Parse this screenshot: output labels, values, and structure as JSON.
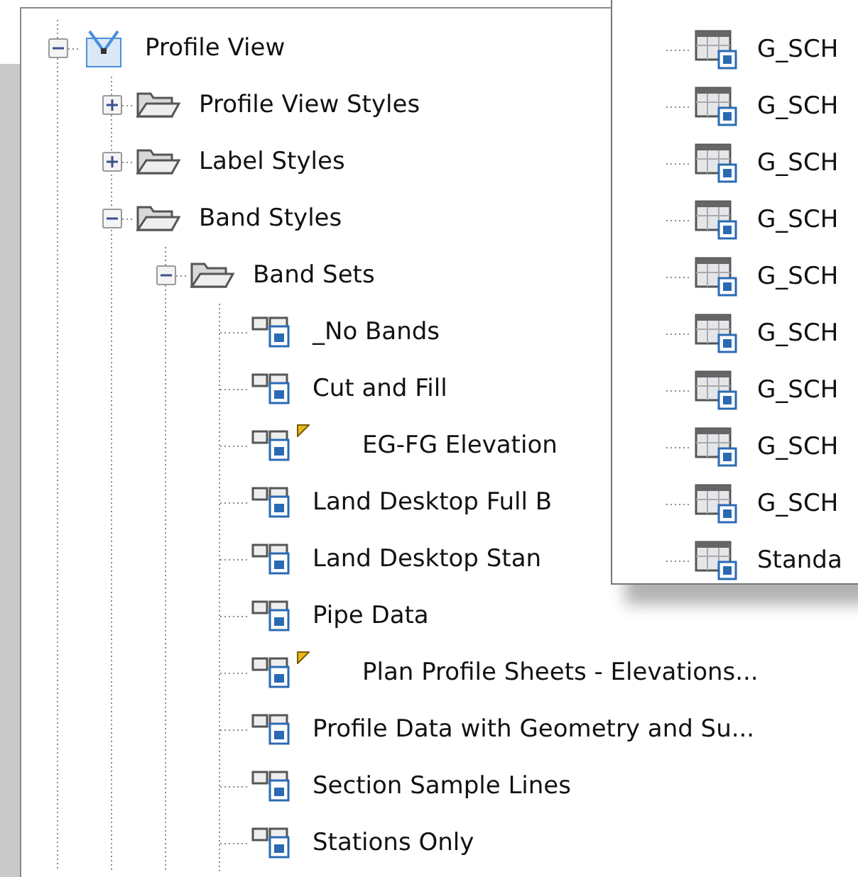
{
  "tree": [
    {
      "label": "Profile View",
      "kind": "profile-view",
      "expanded": true,
      "children": [
        {
          "label": "Profile View Styles",
          "kind": "folder",
          "expanded": false
        },
        {
          "label": "Label Styles",
          "kind": "folder",
          "expanded": false
        },
        {
          "label": "Band Styles",
          "kind": "folder",
          "expanded": true,
          "children": [
            {
              "label": "Band Sets",
              "kind": "folder",
              "expanded": true,
              "children": [
                {
                  "label": "_No Bands",
                  "kind": "band-set",
                  "flagged": false
                },
                {
                  "label": "Cut and Fill",
                  "kind": "band-set",
                  "flagged": false
                },
                {
                  "label": "EG-FG Elevation",
                  "kind": "band-set",
                  "flagged": true
                },
                {
                  "label": "Land Desktop Full B",
                  "kind": "band-set",
                  "flagged": false
                },
                {
                  "label": "Land Desktop Stan",
                  "kind": "band-set",
                  "flagged": false
                },
                {
                  "label": "Pipe Data",
                  "kind": "band-set",
                  "flagged": false
                },
                {
                  "label": "Plan Profile Sheets - Elevations...",
                  "kind": "band-set",
                  "flagged": true
                },
                {
                  "label": "Profile Data with Geometry and Su...",
                  "kind": "band-set",
                  "flagged": false
                },
                {
                  "label": "Section Sample Lines",
                  "kind": "band-set",
                  "flagged": false
                },
                {
                  "label": "Stations Only",
                  "kind": "band-set",
                  "flagged": false
                }
              ]
            }
          ]
        }
      ]
    }
  ],
  "overlay": {
    "items": [
      {
        "label": "G_SCH",
        "kind": "table-style"
      },
      {
        "label": "G_SCH",
        "kind": "table-style"
      },
      {
        "label": "G_SCH",
        "kind": "table-style"
      },
      {
        "label": "G_SCH",
        "kind": "table-style"
      },
      {
        "label": "G_SCH",
        "kind": "table-style"
      },
      {
        "label": "G_SCH",
        "kind": "table-style"
      },
      {
        "label": "G_SCH",
        "kind": "table-style"
      },
      {
        "label": "G_SCH",
        "kind": "table-style"
      },
      {
        "label": "G_SCH",
        "kind": "table-style"
      },
      {
        "label": "Standa",
        "kind": "table-style"
      }
    ]
  }
}
